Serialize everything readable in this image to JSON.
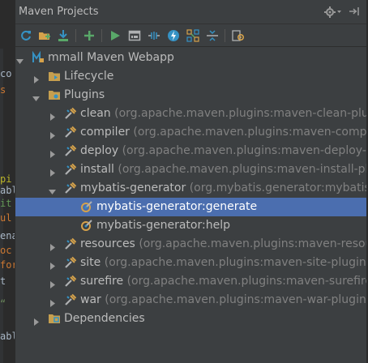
{
  "window": {
    "title": "Maven Projects"
  },
  "editor_fragments": [
    "co",
    "s",
    "pi",
    "abl",
    "it",
    "ul",
    "ena",
    "oc",
    "for",
    "t",
    "“",
    "abl"
  ],
  "tree": {
    "project": "mmall Maven Webapp",
    "lifecycle": "Lifecycle",
    "plugins": "Plugins",
    "dependencies": "Dependencies",
    "plugin_items": [
      {
        "name": "clean",
        "detail": "(org.apache.maven.plugins:maven-clean-plugi"
      },
      {
        "name": "compiler",
        "detail": "(org.apache.maven.plugins:maven-compile"
      },
      {
        "name": "deploy",
        "detail": "(org.apache.maven.plugins:maven-deploy-pl"
      },
      {
        "name": "install",
        "detail": "(org.apache.maven.plugins:maven-install-plug"
      },
      {
        "name": "mybatis-generator",
        "detail": "(org.mybatis.generator:mybatis-g"
      },
      {
        "name": "resources",
        "detail": "(org.apache.maven.plugins:maven-resourc"
      },
      {
        "name": "site",
        "detail": "(org.apache.maven.plugins:maven-site-plugin:3.0"
      },
      {
        "name": "surefire",
        "detail": "(org.apache.maven.plugins:maven-surefire-p"
      },
      {
        "name": "war",
        "detail": "(org.apache.maven.plugins:maven-war-plugin:2."
      }
    ],
    "goals": [
      "mybatis-generator:generate",
      "mybatis-generator:help"
    ]
  },
  "colors": {
    "panel_bg": "#3c3f41",
    "selection": "#4b6eaf",
    "text": "#bbbbbb",
    "detail_text": "#808080",
    "accent_green": "#59a869",
    "accent_blue": "#3592c4"
  },
  "icons": {
    "toolbar": [
      "refresh-icon",
      "add-project-icon",
      "download-icon",
      "add-icon",
      "run-icon",
      "execute-goal-icon",
      "toggle-offline-icon",
      "skip-tests-icon",
      "show-dependencies-icon",
      "collapse-all-icon",
      "settings-icon"
    ],
    "tree": [
      "project-icon",
      "folder-icon",
      "plugin-icon",
      "goal-icon"
    ]
  }
}
